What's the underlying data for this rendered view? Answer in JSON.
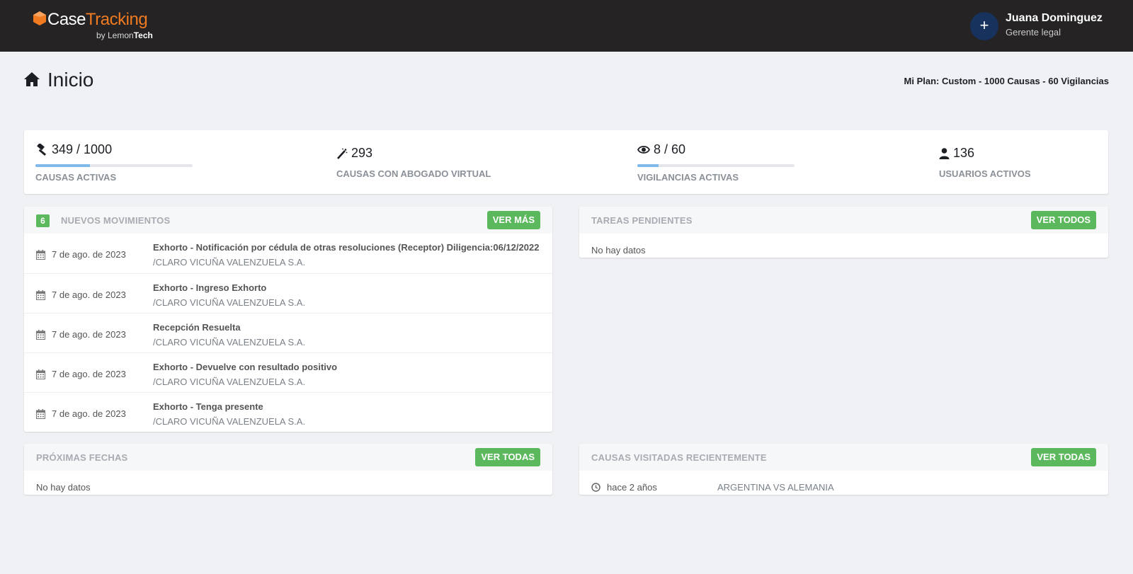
{
  "brand": {
    "name_case": "Case",
    "name_tracking": "Tracking",
    "by": "by Lemon",
    "by_bold": "Tech",
    "orange": "#f07b21"
  },
  "user": {
    "avatar_symbol": "+",
    "name": "Juana Dominguez",
    "role": "Gerente legal"
  },
  "page": {
    "title": "Inicio",
    "plan": "Mi Plan: Custom - 1000 Causas - 60 Vigilancias"
  },
  "stats": {
    "causas": {
      "value": "349 / 1000",
      "label": "CAUSAS ACTIVAS",
      "progress": 0.349,
      "icon": "gavel-icon"
    },
    "abogado": {
      "value": "293",
      "label": "CAUSAS CON ABOGADO VIRTUAL",
      "icon": "magic-wand-icon"
    },
    "vigilancias": {
      "value": "8 / 60",
      "label": "VIGILANCIAS ACTIVAS",
      "progress": 0.133,
      "icon": "eye-icon"
    },
    "usuarios": {
      "value": "136",
      "label": "USUARIOS ACTIVOS",
      "icon": "user-icon"
    }
  },
  "movimientos": {
    "count": "6",
    "title": "NUEVOS MOVIMIENTOS",
    "button": "VER MÁS",
    "rows": [
      {
        "date": "7 de ago. de 2023",
        "title": "Exhorto - Notificación por cédula de otras resoluciones (Receptor) Diligencia:06/12/2022",
        "sub": "/CLARO VICUÑA VALENZUELA S.A."
      },
      {
        "date": "7 de ago. de 2023",
        "title": "Exhorto - Ingreso Exhorto",
        "sub": "/CLARO VICUÑA VALENZUELA S.A."
      },
      {
        "date": "7 de ago. de 2023",
        "title": "Recepción Resuelta",
        "sub": "/CLARO VICUÑA VALENZUELA S.A."
      },
      {
        "date": "7 de ago. de 2023",
        "title": "Exhorto - Devuelve con resultado positivo",
        "sub": "/CLARO VICUÑA VALENZUELA S.A."
      },
      {
        "date": "7 de ago. de 2023",
        "title": "Exhorto - Tenga presente",
        "sub": "/CLARO VICUÑA VALENZUELA S.A."
      }
    ]
  },
  "tareas": {
    "title": "TAREAS PENDIENTES",
    "button": "VER TODOS",
    "empty": "No hay datos"
  },
  "fechas": {
    "title": "PRÓXIMAS FECHAS",
    "button": "VER TODAS",
    "empty": "No hay datos"
  },
  "recientes": {
    "title": "CAUSAS VISITADAS RECIENTEMENTE",
    "button": "VER TODAS",
    "rows": [
      {
        "when": "hace 2 años",
        "name": "ARGENTINA VS ALEMANIA"
      }
    ]
  },
  "colors": {
    "topbar": "#252323",
    "accent_green": "#5cb85c",
    "progress": "#7fb9ea",
    "avatar": "#17325c"
  }
}
